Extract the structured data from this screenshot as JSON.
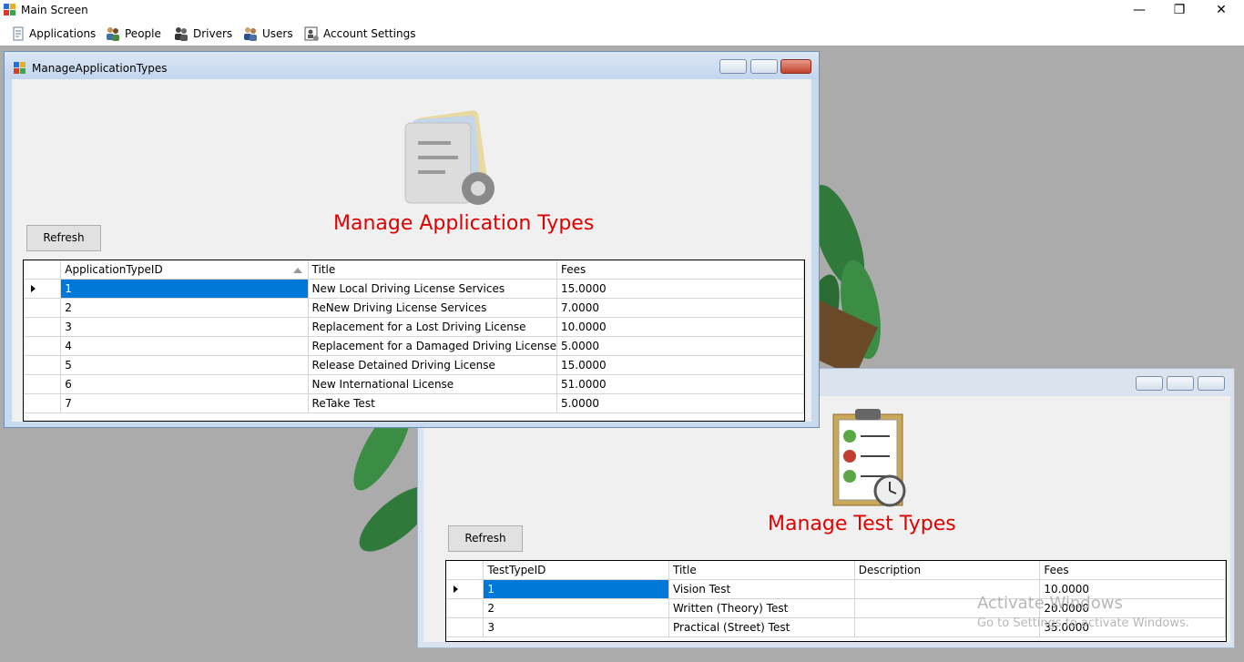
{
  "main_window": {
    "title": "Main Screen",
    "controls": {
      "minimize": "—",
      "restore": "❐",
      "close": "✕"
    }
  },
  "menu": {
    "items": [
      {
        "label": "Applications",
        "icon": "document-icon"
      },
      {
        "label": "People",
        "icon": "people-icon"
      },
      {
        "label": "Drivers",
        "icon": "drivers-icon"
      },
      {
        "label": "Users",
        "icon": "users-icon"
      },
      {
        "label": "Account Settings",
        "icon": "account-settings-icon"
      }
    ]
  },
  "manage_app_types": {
    "title": "ManageApplicationTypes",
    "heading": "Manage Application Types",
    "refresh_label": "Refresh",
    "columns": [
      "ApplicationTypeID",
      "Title",
      "Fees"
    ],
    "rows": [
      [
        "1",
        "New Local Driving License Services",
        "15.0000"
      ],
      [
        "2",
        "ReNew Driving License Services",
        "7.0000"
      ],
      [
        "3",
        "Replacement for a Lost Driving License",
        "10.0000"
      ],
      [
        "4",
        "Replacement for a Damaged Driving License",
        "5.0000"
      ],
      [
        "5",
        "Release Detained Driving License",
        "15.0000"
      ],
      [
        "6",
        "New International License",
        "51.0000"
      ],
      [
        "7",
        "ReTake Test",
        "5.0000"
      ]
    ]
  },
  "manage_test_types": {
    "heading": "Manage Test Types",
    "refresh_label": "Refresh",
    "columns": [
      "TestTypeID",
      "Title",
      "Description",
      "Fees"
    ],
    "rows": [
      [
        "1",
        "Vision Test",
        "",
        "10.0000"
      ],
      [
        "2",
        "Written (Theory) Test",
        "",
        "20.0000"
      ],
      [
        "3",
        "Practical (Street) Test",
        "",
        "35.0000"
      ]
    ]
  },
  "watermark": {
    "line1": "Activate Windows",
    "line2": "Go to Settings to activate Windows."
  },
  "colors": {
    "heading": "#e00000",
    "selection": "#0078d7",
    "mdi_background": "#ababab"
  }
}
